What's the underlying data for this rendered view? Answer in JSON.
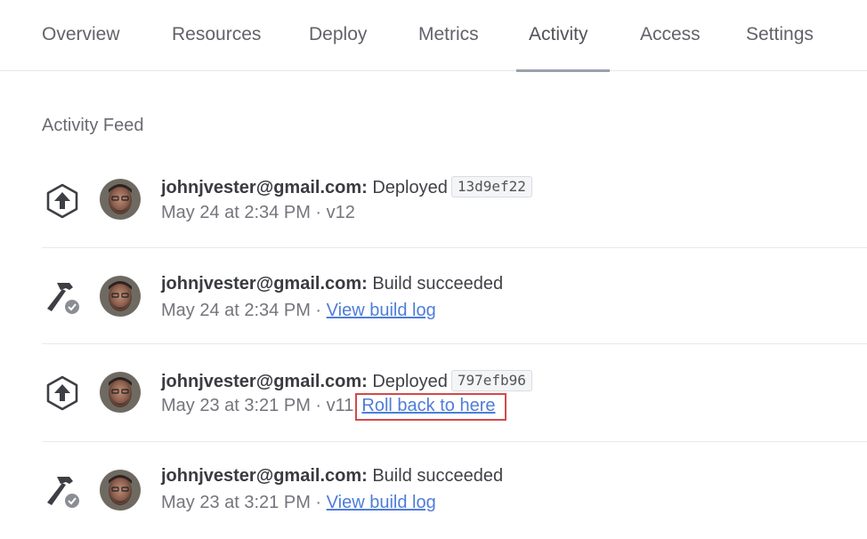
{
  "nav": {
    "tabs": [
      {
        "label": "Overview"
      },
      {
        "label": "Resources"
      },
      {
        "label": "Deploy"
      },
      {
        "label": "Metrics"
      },
      {
        "label": "Activity",
        "active": true
      },
      {
        "label": "Access"
      },
      {
        "label": "Settings"
      }
    ]
  },
  "feed": {
    "title": "Activity Feed",
    "items": [
      {
        "icon": "deploy-upload-icon",
        "user": "johnjvester@gmail.com:",
        "action": "Deployed",
        "sha": "13d9ef22",
        "time": "May 24 at 2:34 PM",
        "sep": " · ",
        "version": "v12"
      },
      {
        "icon": "build-hammer-icon",
        "user": "johnjvester@gmail.com:",
        "action": "Build succeeded",
        "time": "May 24 at 2:34 PM",
        "sep": " · ",
        "link": "View build log"
      },
      {
        "icon": "deploy-upload-icon",
        "user": "johnjvester@gmail.com:",
        "action": "Deployed",
        "sha": "797efb96",
        "time": "May 23 at 3:21 PM",
        "sep": " · ",
        "version": "v11",
        "sep2": " · ",
        "link": "Roll back to here"
      },
      {
        "icon": "build-hammer-icon",
        "user": "johnjvester@gmail.com:",
        "action": "Build succeeded",
        "time": "May 23 at 3:21 PM",
        "sep": " · ",
        "link": "View build log"
      }
    ]
  },
  "colors": {
    "link": "#4f7dd8",
    "highlight_box": "#d24a4a",
    "tab_underline": "#9aa0ac"
  }
}
